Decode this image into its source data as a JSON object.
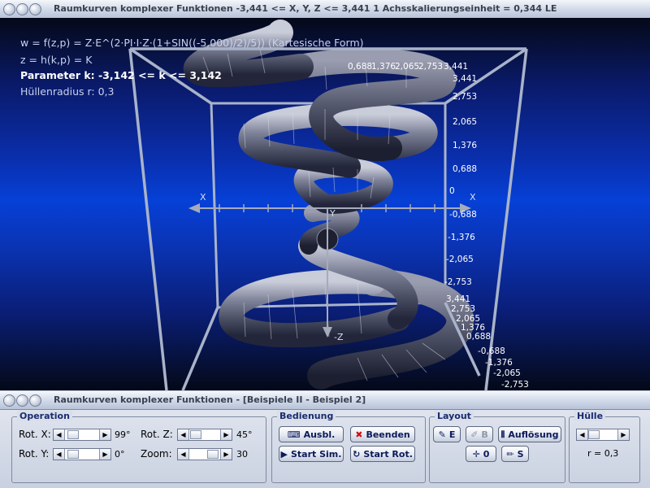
{
  "main_window": {
    "title": "Raumkurven komplexer Funktionen   -3,441 <= X, Y, Z <= 3,441    1 Achsskalierungseinheit = 0,344 LE"
  },
  "info": {
    "line1": "w = f(z,p) = Z·E^(2·PI·I·Z·(1+SIN((-5,000)/2)/5)) (Kartesische Form)",
    "line2": "z = h(k,p) = K",
    "line3": "Parameter k: -3,142 <= k <= 3,142",
    "line4": "Hüllenradius r: 0,3"
  },
  "axes": {
    "x_neg": "X",
    "x_pos": "X",
    "y": "Y",
    "z_neg": "-Z",
    "top_ticks": [
      "0,688",
      "1,376",
      "2,065",
      "2,753",
      "3,441"
    ],
    "right_ticks": [
      "3,441",
      "2,753",
      "2,065",
      "1,376",
      "0,688",
      "0",
      "-0,688",
      "-1,376",
      "-2,065",
      "-2,753"
    ],
    "lower_ticks": [
      "3,441",
      "2,753",
      "2,065",
      "1,376",
      "0,688",
      "-0,688",
      "-1,376",
      "-2,065",
      "-2,753"
    ]
  },
  "panel_window": {
    "title": "Raumkurven komplexer Funktionen - [Beispiele II - Beispiel 2]"
  },
  "operation": {
    "title": "Operation",
    "rot_x_label": "Rot. X:",
    "rot_x_value": "99°",
    "rot_y_label": "Rot. Y:",
    "rot_y_value": "0°",
    "rot_z_label": "Rot. Z:",
    "rot_z_value": "45°",
    "zoom_label": "Zoom:",
    "zoom_value": "30"
  },
  "bedienung": {
    "title": "Bedienung",
    "ausbl": "Ausbl.",
    "beenden": "Beenden",
    "start_sim": "Start Sim.",
    "start_rot": "Start Rot."
  },
  "layout": {
    "title": "Layout",
    "btn_e": "E",
    "btn_b": "B",
    "aufloesung": "Auflösung",
    "btn_0": "0",
    "btn_s": "S"
  },
  "huelle": {
    "title": "Hülle",
    "value": "r = 0,3"
  },
  "colors": {
    "accent_title": "#1a2a6e",
    "beenden_icon": "#cc1111",
    "tube": "#5b6078"
  }
}
